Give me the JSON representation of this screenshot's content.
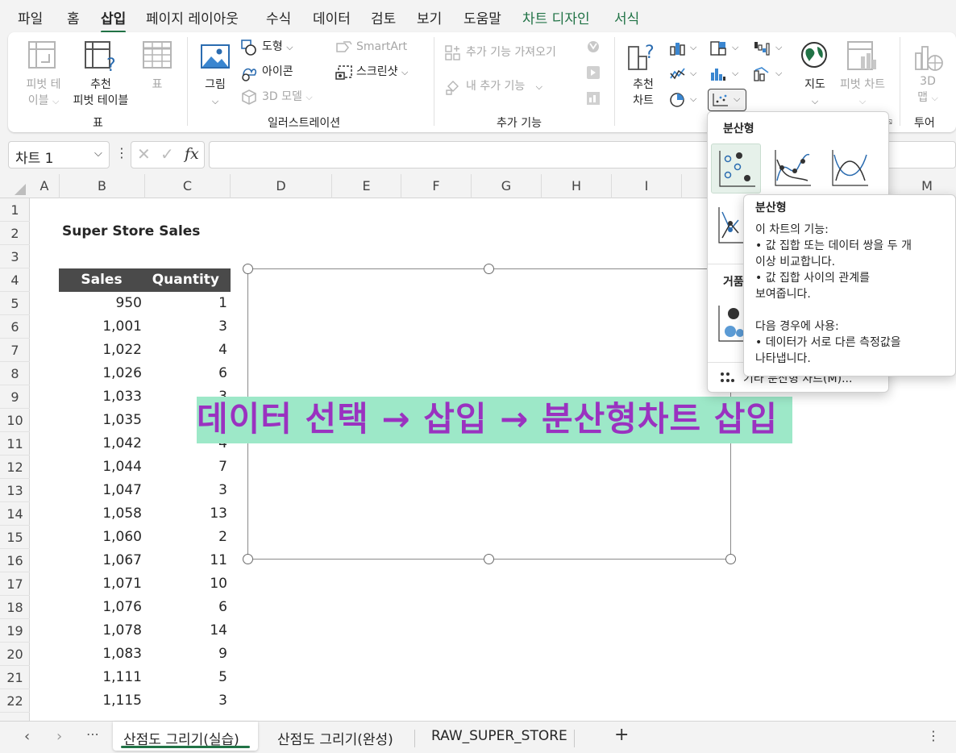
{
  "menu": {
    "tabs": [
      {
        "label": "파일"
      },
      {
        "label": "홈"
      },
      {
        "label": "삽입"
      },
      {
        "label": "페이지 레이아웃"
      },
      {
        "label": "수식"
      },
      {
        "label": "데이터"
      },
      {
        "label": "검토"
      },
      {
        "label": "보기"
      },
      {
        "label": "도움말"
      },
      {
        "label": "차트 디자인"
      },
      {
        "label": "서식"
      }
    ],
    "active": "삽입"
  },
  "ribbon": {
    "table_group": {
      "pivot_line1": "피벗 테",
      "pivot_line2": "이블",
      "rec_pivot_line1": "추천",
      "rec_pivot_line2": "피벗 테이블",
      "table": "표",
      "group_label": "표"
    },
    "illustrations": {
      "picture": "그림",
      "shapes": "도형",
      "icons": "아이콘",
      "models3d": "3D 모델",
      "smartart": "SmartArt",
      "screenshot": "스크린샷",
      "group_label": "일러스트레이션"
    },
    "addins": {
      "get": "추가 기능 가져오기",
      "my": "내 추가 기능",
      "group_label": "추가 기능"
    },
    "charts": {
      "rec_line1": "추천",
      "rec_line2": "차트",
      "map": "지도",
      "pivot_chart": "피벗 차트"
    },
    "tours": {
      "map3d_line1": "3D",
      "map3d_line2": "맵",
      "group_label": "투어"
    }
  },
  "formula_bar": {
    "name_box": "차트 1",
    "fx": "fx",
    "formula": ""
  },
  "columns": [
    "A",
    "B",
    "C",
    "D",
    "E",
    "F",
    "G",
    "H",
    "I",
    "M"
  ],
  "rows": [
    "1",
    "2",
    "3",
    "4",
    "5",
    "6",
    "7",
    "8",
    "9",
    "10",
    "11",
    "12",
    "13",
    "14",
    "15",
    "16",
    "17",
    "18",
    "19",
    "20",
    "21",
    "22"
  ],
  "sheet": {
    "title": "Super Store Sales",
    "headers": [
      "Sales",
      "Quantity"
    ],
    "data": [
      [
        "950",
        "1"
      ],
      [
        "1,001",
        "3"
      ],
      [
        "1,022",
        "4"
      ],
      [
        "1,026",
        "6"
      ],
      [
        "1,033",
        "3"
      ],
      [
        "1,035",
        ""
      ],
      [
        "1,042",
        "4"
      ],
      [
        "1,044",
        "7"
      ],
      [
        "1,047",
        "3"
      ],
      [
        "1,058",
        "13"
      ],
      [
        "1,060",
        "2"
      ],
      [
        "1,067",
        "11"
      ],
      [
        "1,071",
        "10"
      ],
      [
        "1,076",
        "6"
      ],
      [
        "1,078",
        "14"
      ],
      [
        "1,083",
        "9"
      ],
      [
        "1,111",
        "5"
      ],
      [
        "1,115",
        "3"
      ]
    ]
  },
  "banner": {
    "text": "데이터 선택 → 삽입 →  분산형차트 삽입"
  },
  "scatter_menu": {
    "title": "분산형",
    "bubble_partial": "거품",
    "more_partial": "기타 분산형 차트(M)..."
  },
  "tooltip": {
    "title": "분산형",
    "lines": [
      "이 차트의 기능:",
      "• 값 집합 또는 데이터 쌍을 두 개",
      "이상 비교합니다.",
      "• 값 집합 사이의 관계를",
      "보여줍니다.",
      "",
      "다음 경우에 사용:",
      "• 데이터가 서로 다른 측정값을",
      "나타냅니다."
    ]
  },
  "sheet_tabs": {
    "tabs": [
      {
        "label": "산점도 그리기(실습)"
      },
      {
        "label": "산점도 그리기(완성)"
      },
      {
        "label": "RAW_SUPER_STORE"
      }
    ],
    "active": "산점도 그리기(실습)",
    "add": "+",
    "more": "⋯"
  },
  "colors": {
    "accent": "#217346",
    "banner_bg": "#9de8c8",
    "banner_text": "#9a32c0",
    "header_fill": "#4a4a4a"
  }
}
